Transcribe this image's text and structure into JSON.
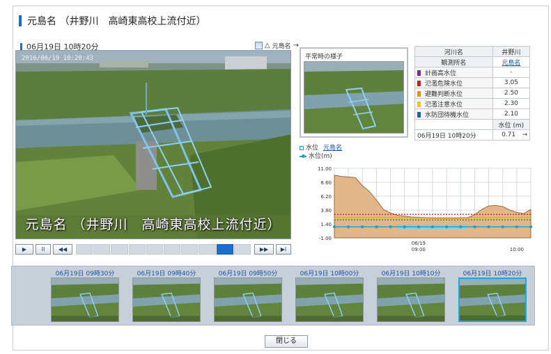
{
  "window": {
    "title": "元島名 （井野川　高崎東高校上流付近）"
  },
  "camera": {
    "datetime": "06月19日 10時20分",
    "nav_label": "元島名",
    "nav_arrow_left": "△",
    "nav_arrow_right": "→",
    "photo_timestamp": "2016/06/19 10:20:43",
    "photo_caption": "元島名 （井野川　高崎東高校上流付近）"
  },
  "controls": {
    "play": "▶",
    "pause": "II",
    "rewind": "◀◀",
    "forward": "▶▶",
    "last": "▶I",
    "timeline_segments": 10,
    "timeline_active_index": 8
  },
  "normal_panel": {
    "title": "平常時の様子"
  },
  "info_table": {
    "river_label": "河川名",
    "river_value": "井野川",
    "station_label": "観測所名",
    "station_value": "元島名",
    "levels": [
      {
        "label": "計画高水位",
        "value": "-",
        "color": "#7a2a9a"
      },
      {
        "label": "氾濫危険水位",
        "value": "3.05",
        "color": "#c81e1e"
      },
      {
        "label": "避難判断水位",
        "value": "2.50",
        "color": "#e8901c"
      },
      {
        "label": "氾濫注意水位",
        "value": "2.30",
        "color": "#e8c81c"
      },
      {
        "label": "水防団待機水位",
        "value": "2.10",
        "color": "#1d5fb8"
      }
    ],
    "level_header": "水位 (m)",
    "current_datetime": "06月19日 10時20分",
    "current_value": "0.71",
    "current_arrow": "→"
  },
  "legend": {
    "item1_label": "水位",
    "item1_link": "元島名",
    "item2_label": "水位(m)"
  },
  "chart_data": {
    "type": "area",
    "y_ticks": [
      "11.00",
      "8.60",
      "6.20",
      "3.80",
      "1.40",
      "-1.00"
    ],
    "ylim": [
      -1.0,
      11.0
    ],
    "x_tick_labels": [
      {
        "line1": "06/19",
        "line2": "09:00"
      },
      {
        "line1": "",
        "line2": "10:00"
      }
    ],
    "xlim": [
      0,
      28
    ],
    "terrain": {
      "x": [
        0,
        1,
        3,
        4,
        5,
        6,
        7,
        8,
        9,
        11,
        13,
        15,
        17,
        19,
        20,
        21,
        22,
        23,
        24,
        25,
        26,
        27,
        28
      ],
      "y": [
        9.8,
        9.6,
        9.4,
        8.0,
        7.0,
        5.5,
        3.9,
        3.3,
        2.9,
        2.6,
        2.5,
        2.4,
        2.4,
        2.5,
        3.0,
        3.9,
        4.5,
        4.6,
        4.4,
        3.8,
        3.4,
        3.2,
        3.9
      ]
    },
    "water_level": {
      "x": [
        0,
        2,
        4,
        6,
        8,
        10,
        12,
        14,
        16,
        18,
        20,
        22,
        24,
        26,
        28
      ],
      "y": [
        0.9,
        0.9,
        0.9,
        0.9,
        0.9,
        0.9,
        0.9,
        0.9,
        0.9,
        0.9,
        0.9,
        0.9,
        0.9,
        0.9,
        0.9
      ]
    },
    "threshold_lines": [
      {
        "value": 3.05,
        "color": "#c81e1e"
      },
      {
        "value": 2.5,
        "color": "#e8901c"
      },
      {
        "value": 2.3,
        "color": "#e8c81c"
      },
      {
        "value": 2.1,
        "color": "#1d5fb8"
      }
    ],
    "colors": {
      "terrain": "#e0b68a",
      "terrain_edge": "#9a6a3a",
      "water": "#7fd0ea",
      "series": "#2b9fc0"
    }
  },
  "thumbnails": [
    {
      "label": "06月19日 09時30分"
    },
    {
      "label": "06月19日 09時40分"
    },
    {
      "label": "06月19日 09時50分"
    },
    {
      "label": "06月19日 10時00分"
    },
    {
      "label": "06月19日 10時10分"
    },
    {
      "label": "06月19日 10時20分"
    }
  ],
  "thumbnail_selected_index": 5,
  "close_label": "閉じる"
}
